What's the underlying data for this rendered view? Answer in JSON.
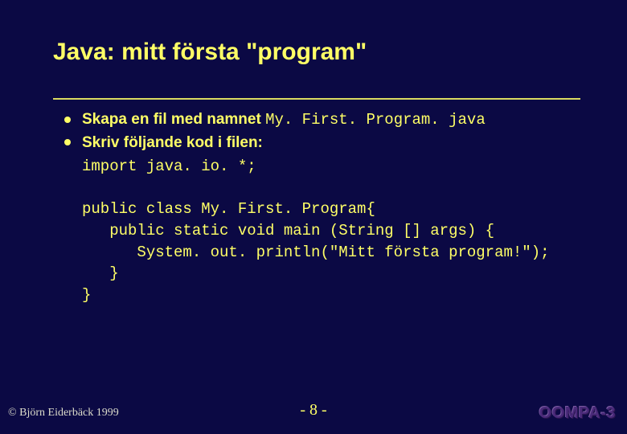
{
  "slide": {
    "title": "Java: mitt första \"program\"",
    "bullets": [
      {
        "text": "Skapa en fil med namnet ",
        "code": "My. First. Program. java"
      },
      {
        "text": "Skriv följande kod i filen:",
        "code": ""
      }
    ],
    "code": "import java. io. *;\n\npublic class My. First. Program{\n   public static void main (String [] args) {\n      System. out. println(\"Mitt första program!\");\n   }\n}"
  },
  "footer": {
    "copyright": "© Björn Eiderbäck 1999",
    "page": "- 8 -",
    "course": "OOMPA-3"
  }
}
